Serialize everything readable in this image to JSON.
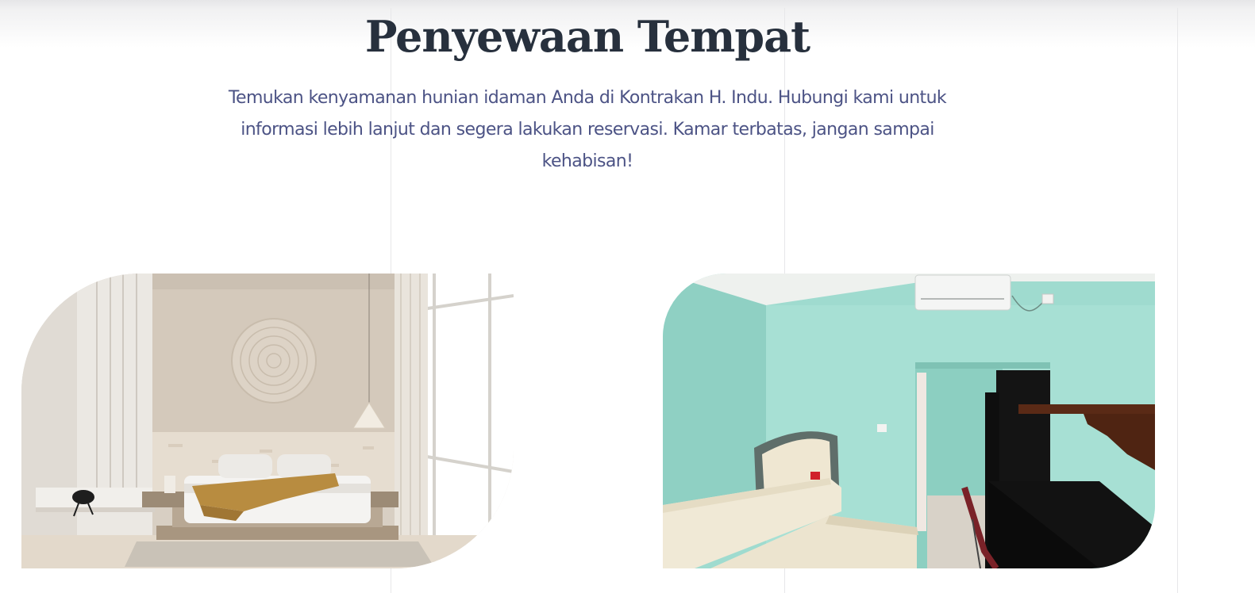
{
  "section": {
    "title": "Penyewaan Tempat",
    "description": "Temukan kenyamanan hunian idaman Anda di Kontrakan H. Indu. Hubungi kami untuk informasi lebih lanjut dan segera lakukan reservasi. Kamar terbatas, jangan sampai kehabisan!"
  },
  "photos": [
    {
      "subject": "modern-beige-bedroom"
    },
    {
      "subject": "mint-green-rental-room"
    }
  ],
  "colors": {
    "title": "#27303d",
    "description": "#4c5385",
    "grid_line": "#e7e7e9"
  }
}
